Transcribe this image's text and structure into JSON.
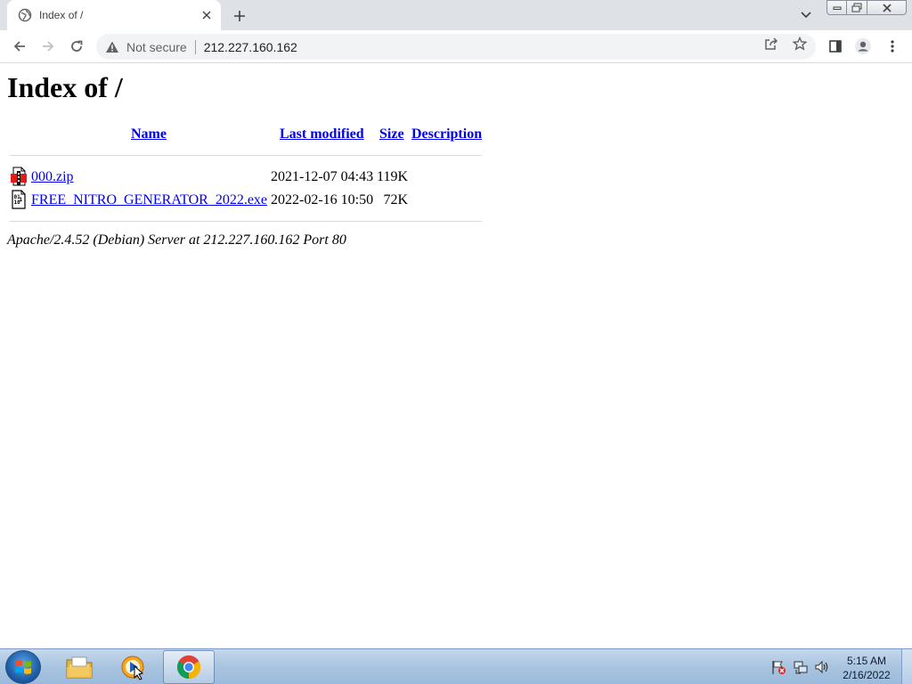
{
  "browser": {
    "tab_title": "Index of /",
    "security_label": "Not secure",
    "url": "212.227.160.162"
  },
  "page": {
    "heading": "Index of /",
    "columns": {
      "name": "Name",
      "last_modified": "Last modified",
      "size": "Size",
      "description": "Description"
    },
    "files": [
      {
        "name": "000.zip",
        "last_modified": "2021-12-07 04:43",
        "size": "119K",
        "description": "",
        "icon": "compressed-file-icon"
      },
      {
        "name": "FREE_NITRO_GENERATOR_2022.exe",
        "last_modified": "2022-02-16 10:50",
        "size": "72K",
        "description": "",
        "icon": "binary-file-icon"
      }
    ],
    "address": "Apache/2.4.52 (Debian) Server at 212.227.160.162 Port 80"
  },
  "taskbar": {
    "apps": [
      "file-explorer-icon",
      "media-player-icon",
      "chrome-icon"
    ],
    "active_app": "chrome-icon",
    "clock": {
      "time": "5:15 AM",
      "date": "2/16/2022"
    }
  },
  "colors": {
    "link": "#0000ee",
    "tabstrip_bg": "#dee1e6",
    "omnibox_bg": "#f1f3f4",
    "taskbar_top": "#c5d8ec",
    "taskbar_bottom": "#9bbadb"
  }
}
